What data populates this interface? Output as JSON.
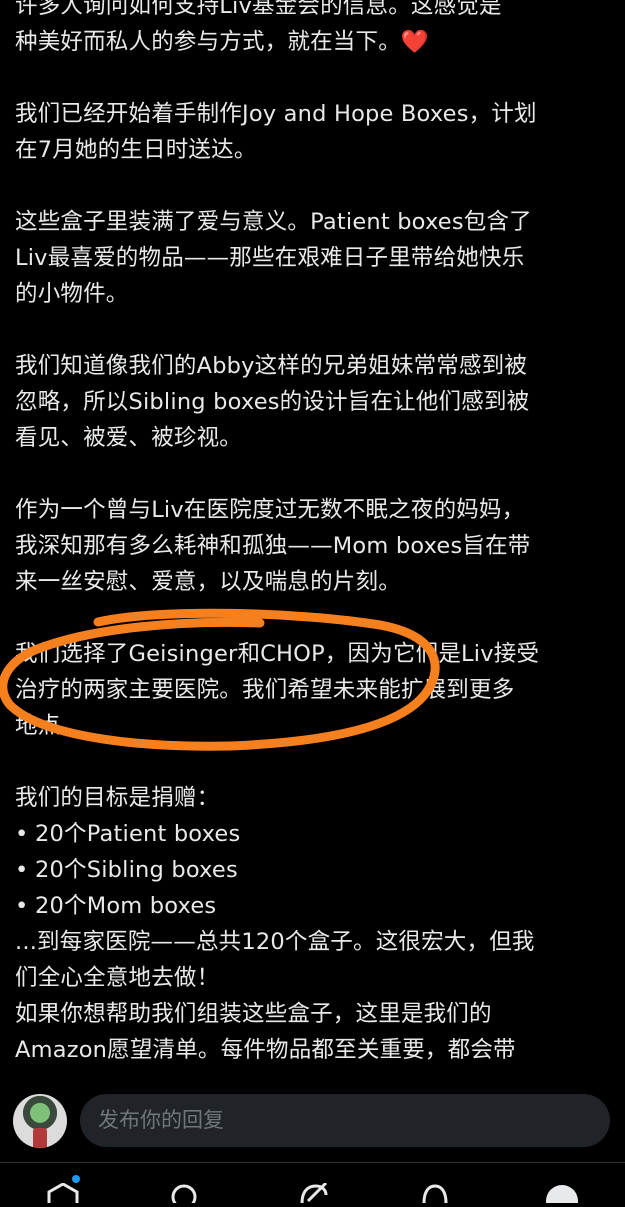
{
  "post": {
    "top_partial": "许多人询问如何支持Liv基金会的信息。这感觉是",
    "p1_line2": "种美好而私人的参与方式，就在当下。",
    "heart": "❤️",
    "p2_line1": "我们已经开始着手制作Joy and Hope Boxes，计划",
    "p2_line2": "在7月她的生日时送达。",
    "p3_line1": "这些盒子里装满了爱与意义。Patient boxes包含了",
    "p3_line2": "Liv最喜爱的物品——那些在艰难日子里带给她快乐",
    "p3_line3": "的小物件。",
    "p4_line1": "我们知道像我们的Abby这样的兄弟姐妹常常感到被",
    "p4_line2": "忽略，所以Sibling boxes的设计旨在让他们感到被",
    "p4_line3": "看见、被爱、被珍视。",
    "p5_line1": "作为一个曾与Liv在医院度过无数不眠之夜的妈妈，",
    "p5_line2": "我深知那有多么耗神和孤独——Mom boxes旨在带",
    "p5_line3": "来一丝安慰、爱意，以及喘息的片刻。",
    "p6_line1": "我们选择了Geisinger和CHOP，因为它们是Liv接受",
    "p6_line2": "治疗的两家主要医院。我们希望未来能扩展到更多",
    "p6_line3": "地点。",
    "p7_line1": "我们的目标是捐赠：",
    "bullets": [
      "20个Patient boxes",
      "20个Sibling boxes",
      "20个Mom boxes"
    ],
    "bullet_char": "•",
    "p8_line1": "...到每家医院——总共120个盒子。这很宏大，但我",
    "p8_line2": "们全心全意地去做！",
    "p9_line1": "如果你想帮助我们组装这些盒子，这里是我们的",
    "p9_line2": "Amazon愿望清单。每件物品都至关重要，都会带"
  },
  "reply": {
    "placeholder": "发布你的回复"
  },
  "annotation": {
    "color": "#f7801e"
  },
  "icons": {
    "home": "home-icon",
    "search": "search-icon",
    "grok": "grok-icon",
    "notifications": "bell-icon",
    "profile": "profile-icon"
  },
  "colors": {
    "background": "#000000",
    "text": "#e7e9ea",
    "placeholder": "#71767b",
    "input_bg": "#202327",
    "accent": "#1d9bf0",
    "heart": "#e0243a"
  }
}
